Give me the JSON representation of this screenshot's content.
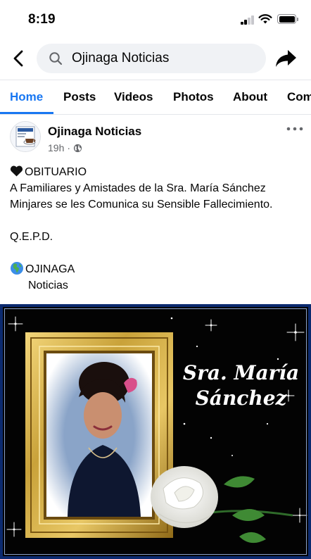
{
  "status_bar": {
    "time": "8:19"
  },
  "search": {
    "value": "Ojinaga Noticias"
  },
  "tabs": [
    {
      "label": "Home"
    },
    {
      "label": "Posts"
    },
    {
      "label": "Videos"
    },
    {
      "label": "Photos"
    },
    {
      "label": "About"
    },
    {
      "label": "Com"
    }
  ],
  "post": {
    "page_name": "Ojinaga Noticias",
    "time": "19h",
    "separator": "·",
    "lines": [
      "OBITUARIO",
      "A Familiares y Amistades de la Sra. María Sánchez",
      "Minjares se les Comunica su Sensible Fallecimiento.",
      "Q.E.P.D.",
      "OJINAGA",
      "Noticias"
    ],
    "image": {
      "name_line_1": "Sra. María",
      "name_line_2": "Sánchez"
    }
  },
  "colors": {
    "accent": "#1877f2",
    "secondary_text": "#65676b",
    "frame_gold": "#c9a23a",
    "image_border": "#0b2a6f"
  }
}
